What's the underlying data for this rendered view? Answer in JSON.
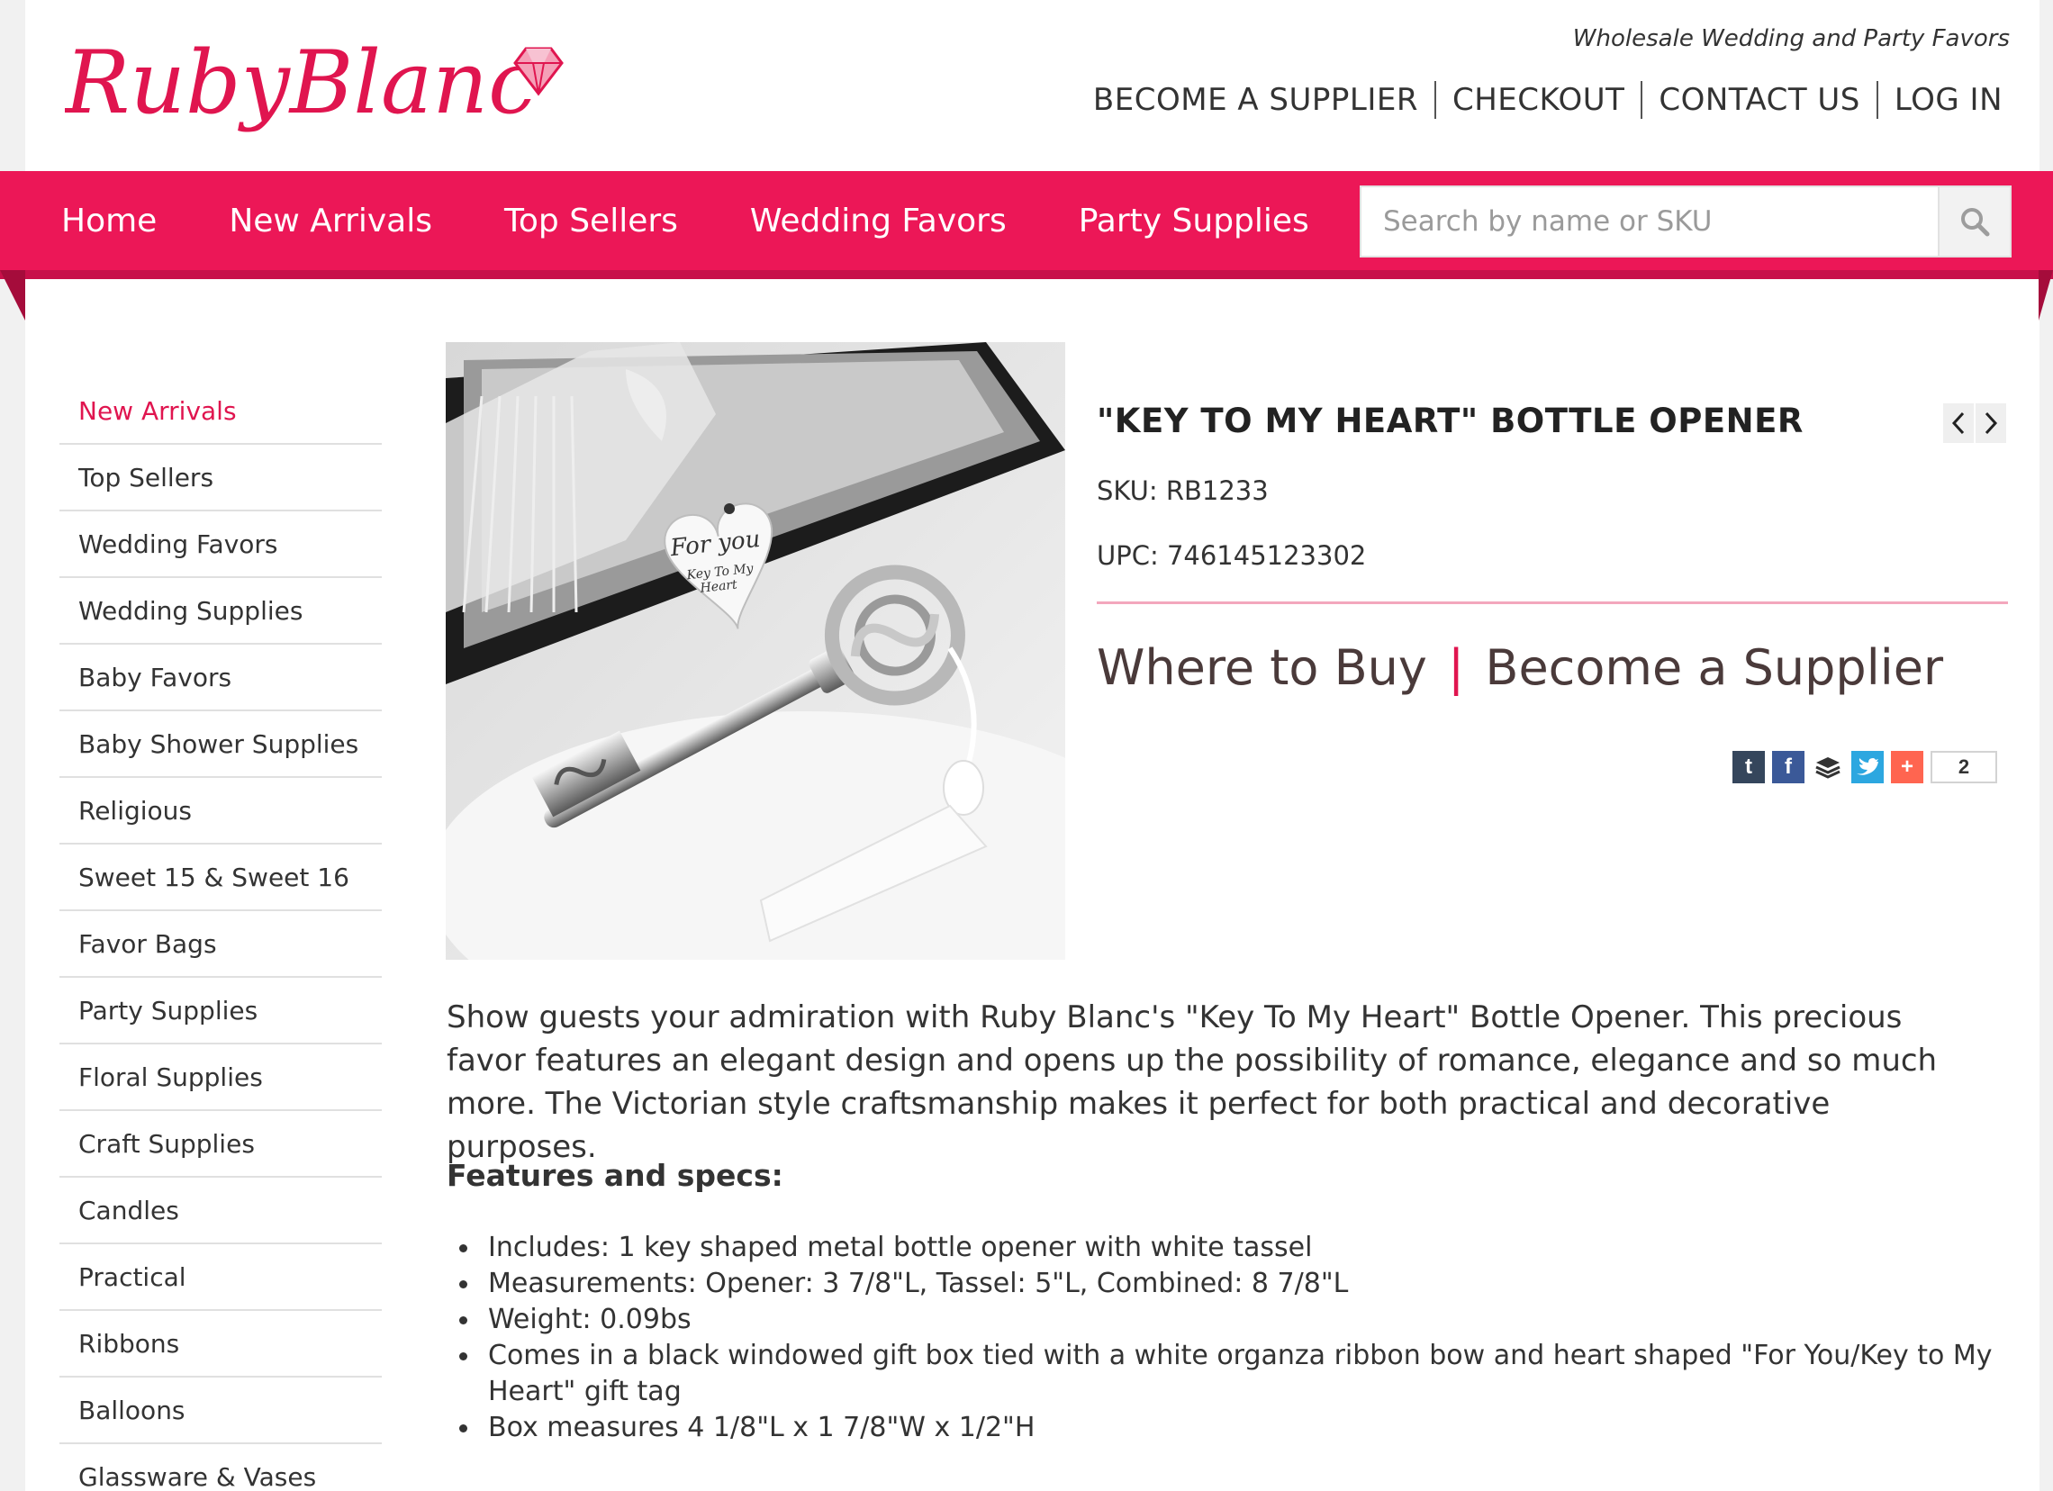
{
  "brand": {
    "logo_text": "RubyBlanc",
    "tagline": "Wholesale Wedding and Party Favors",
    "accent": "#ec1757"
  },
  "top_nav": [
    "BECOME A SUPPLIER",
    "CHECKOUT",
    "CONTACT US",
    "LOG IN"
  ],
  "main_nav": [
    "Home",
    "New Arrivals",
    "Top Sellers",
    "Wedding Favors",
    "Party Supplies"
  ],
  "search": {
    "placeholder": "Search by name or SKU",
    "icon": "search-icon"
  },
  "sidebar": [
    "New Arrivals",
    "Top Sellers",
    "Wedding Favors",
    "Wedding Supplies",
    "Baby Favors",
    "Baby Shower Supplies",
    "Religious",
    "Sweet 15 & Sweet 16",
    "Favor Bags",
    "Party Supplies",
    "Floral Supplies",
    "Craft Supplies",
    "Candles",
    "Practical",
    "Ribbons",
    "Balloons",
    "Glassware & Vases"
  ],
  "sidebar_active": "New Arrivals",
  "product": {
    "title": "\"KEY TO MY HEART\" BOTTLE OPENER",
    "sku": "SKU: RB1233",
    "upc": "UPC: 746145123302",
    "where_to_buy": "Where to Buy",
    "pipe": "|",
    "become_supplier": "Become a Supplier",
    "tag_line1": "For you",
    "tag_line2": "Key To My",
    "tag_line3": "Heart",
    "share": {
      "icons": [
        "tumblr-icon",
        "facebook-icon",
        "buffer-icon",
        "twitter-icon",
        "addthis-icon"
      ],
      "count": "2"
    },
    "description": "Show guests your admiration with Ruby Blanc's \"Key To My Heart\" Bottle Opener. This precious favor features an elegant design and opens up the possibility of romance, elegance and so much more. The Victorian style craftsmanship makes it perfect for both practical and decorative purposes.",
    "features_heading": "Features and specs:",
    "specs": [
      "Includes: 1 key shaped metal bottle opener with white tassel",
      "Measurements: Opener: 3 7/8\"L, Tassel: 5\"L, Combined: 8 7/8\"L",
      "Weight: 0.09bs",
      "Comes in a black windowed gift box tied with a white organza ribbon bow and heart shaped \"For You/Key to My Heart\" gift tag",
      "Box measures 4 1/8\"L x 1 7/8\"W x 1/2\"H"
    ]
  }
}
